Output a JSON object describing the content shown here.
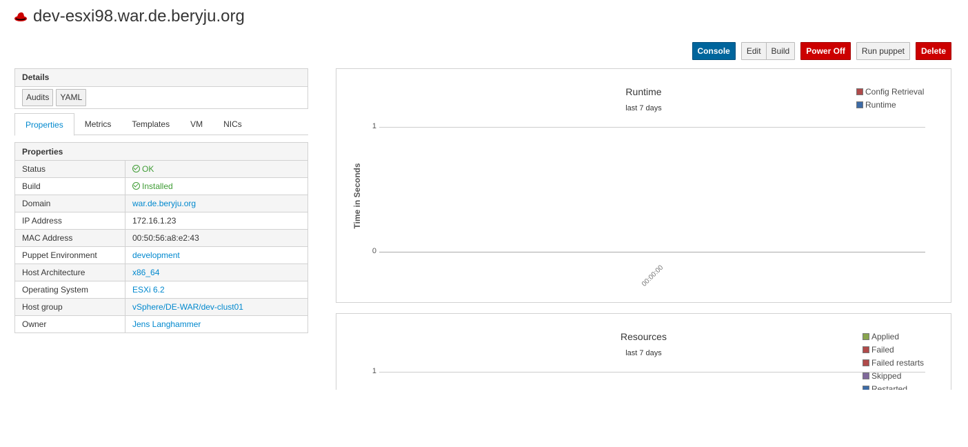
{
  "page": {
    "title": "dev-esxi98.war.de.beryju.org"
  },
  "actions": {
    "console": "Console",
    "edit": "Edit",
    "build": "Build",
    "power_off": "Power Off",
    "run_puppet": "Run puppet",
    "delete": "Delete"
  },
  "details": {
    "title": "Details",
    "audits": "Audits",
    "yaml": "YAML"
  },
  "tabs": [
    "Properties",
    "Metrics",
    "Templates",
    "VM",
    "NICs"
  ],
  "properties": {
    "title": "Properties",
    "rows": [
      {
        "label": "Status",
        "value": "OK",
        "kind": "ok"
      },
      {
        "label": "Build",
        "value": "Installed",
        "kind": "ok"
      },
      {
        "label": "Domain",
        "value": "war.de.beryju.org",
        "kind": "link"
      },
      {
        "label": "IP Address",
        "value": "172.16.1.23",
        "kind": "text"
      },
      {
        "label": "MAC Address",
        "value": "00:50:56:a8:e2:43",
        "kind": "text"
      },
      {
        "label": "Puppet Environment",
        "value": "development",
        "kind": "link"
      },
      {
        "label": "Host Architecture",
        "value": "x86_64",
        "kind": "link"
      },
      {
        "label": "Operating System",
        "value": "ESXi 6.2",
        "kind": "link"
      },
      {
        "label": "Host group",
        "value": "vSphere/DE-WAR/dev-clust01",
        "kind": "link"
      },
      {
        "label": "Owner",
        "value": "Jens Langhammer",
        "kind": "link"
      }
    ]
  },
  "colors": {
    "primary": "#00659c",
    "danger": "#cc0000",
    "link": "#0088ce",
    "ok": "#3f9c35"
  },
  "chart_data": [
    {
      "type": "line",
      "title": "Runtime",
      "subtitle": "last 7 days",
      "ylabel": "Time in Seconds",
      "x": [
        "00:00:00"
      ],
      "yticks": [
        "1",
        "0"
      ],
      "ylim": [
        0,
        1
      ],
      "legend_position": "top-right",
      "series": [
        {
          "name": "Config Retrieval",
          "color": "#b04a4a",
          "values": []
        },
        {
          "name": "Runtime",
          "color": "#3d6ba6",
          "values": []
        }
      ]
    },
    {
      "type": "line",
      "title": "Resources",
      "subtitle": "last 7 days",
      "yticks": [
        "1"
      ],
      "legend_position": "top-right",
      "series": [
        {
          "name": "Applied",
          "color": "#89a54e",
          "values": []
        },
        {
          "name": "Failed",
          "color": "#b04a4a",
          "values": []
        },
        {
          "name": "Failed restarts",
          "color": "#b04a4a",
          "values": []
        },
        {
          "name": "Skipped",
          "color": "#80699b",
          "values": []
        },
        {
          "name": "Restarted",
          "color": "#3d6ba6",
          "values": []
        }
      ]
    }
  ]
}
